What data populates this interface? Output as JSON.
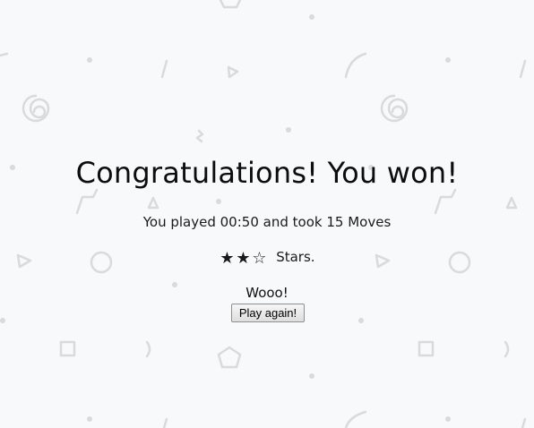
{
  "win": {
    "title": "Congratulations! You won!",
    "summary_prefix": "You played",
    "time": "00:50",
    "summary_middle": "and took",
    "moves": "15",
    "moves_label": "Moves",
    "stars_earned": 2,
    "stars_total": 3,
    "stars_label": "Stars.",
    "cheer": "Wooo!",
    "play_again_label": "Play again!"
  },
  "colors": {
    "background": "#f8f9fa",
    "pattern": "#d9dadc",
    "text": "#111111"
  },
  "icons": {
    "star_filled": "star-filled-icon",
    "star_empty": "star-empty-icon"
  }
}
